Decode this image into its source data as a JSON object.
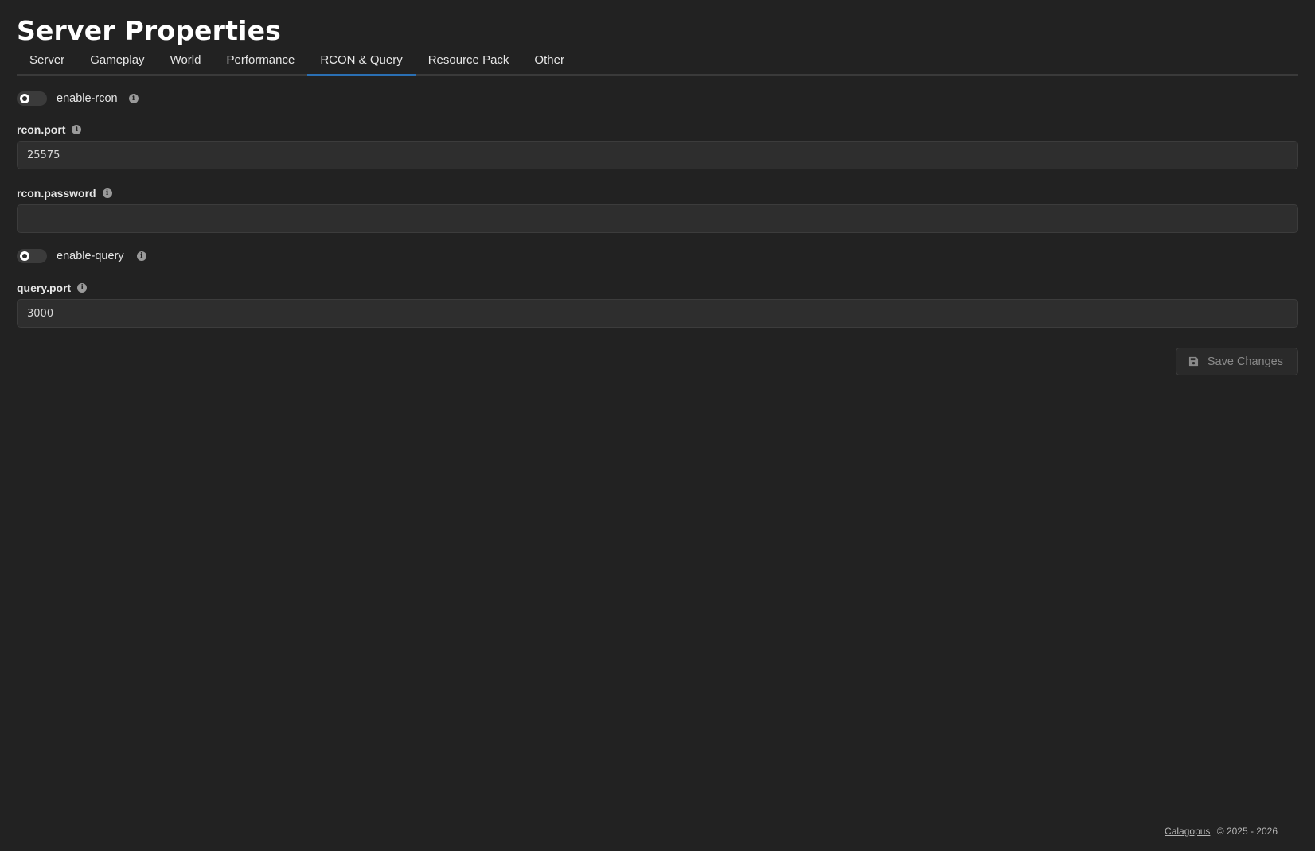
{
  "page": {
    "title": "Server Properties"
  },
  "tabs": [
    {
      "label": "Server"
    },
    {
      "label": "Gameplay"
    },
    {
      "label": "World"
    },
    {
      "label": "Performance"
    },
    {
      "label": "RCON & Query",
      "active": true
    },
    {
      "label": "Resource Pack"
    },
    {
      "label": "Other"
    }
  ],
  "fields": {
    "enable_rcon": {
      "label": "enable-rcon",
      "enabled": false
    },
    "rcon_port": {
      "label": "rcon.port",
      "value": "25575"
    },
    "rcon_password": {
      "label": "rcon.password",
      "value": ""
    },
    "enable_query": {
      "label": "enable-query",
      "enabled": false
    },
    "query_port": {
      "label": "query.port",
      "value": "3000"
    }
  },
  "actions": {
    "save_label": "Save Changes"
  },
  "footer": {
    "brand": "Calagopus",
    "copyright": "© 2025 - 2026"
  },
  "colors": {
    "background": "#222222",
    "accent": "#2a6fb3"
  }
}
